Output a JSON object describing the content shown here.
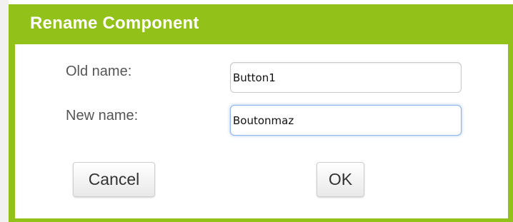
{
  "dialog": {
    "title": "Rename Component",
    "old_name_label": "Old name:",
    "old_name_value": "Button1",
    "new_name_label": "New name:",
    "new_name_value": "Boutonmaz",
    "cancel_label": "Cancel",
    "ok_label": "OK"
  },
  "colors": {
    "title_bar": "#92c21a",
    "focus_ring": "#8fb6e8"
  }
}
